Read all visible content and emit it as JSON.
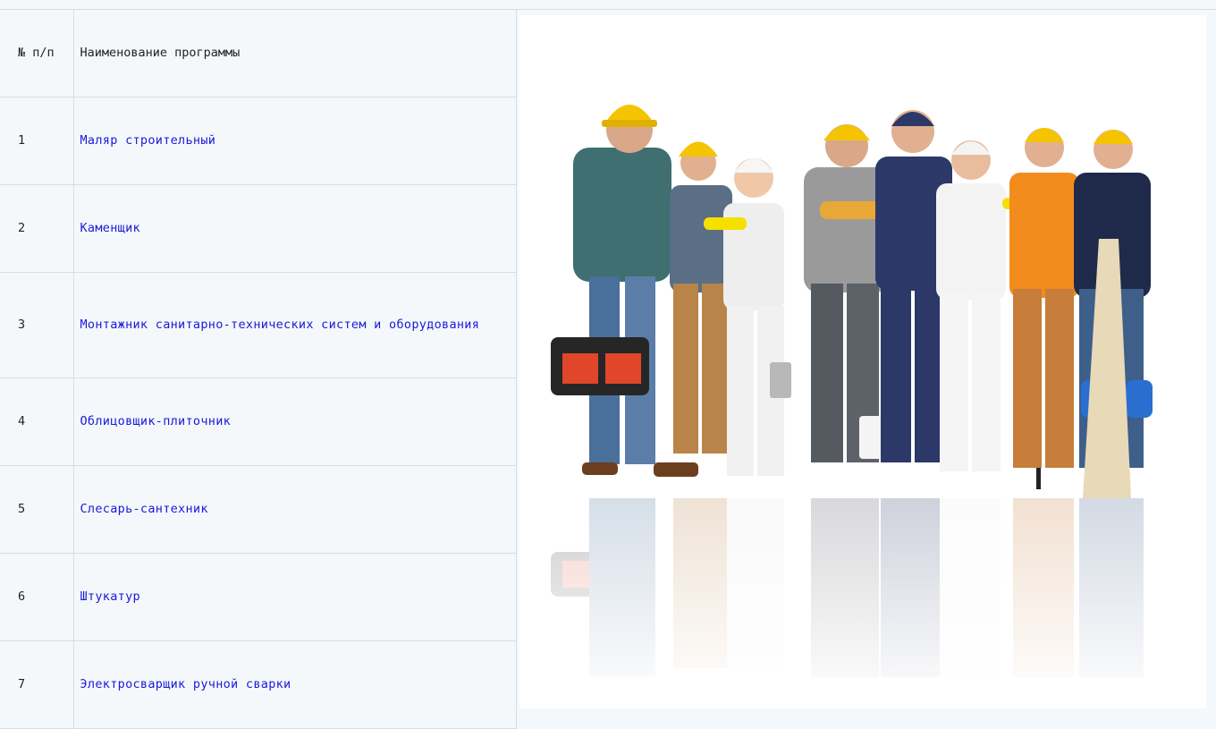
{
  "table": {
    "header": {
      "num": "№ п/п",
      "name": "Наименование программы"
    },
    "rows": [
      {
        "num": "1",
        "name": "Маляр строительный"
      },
      {
        "num": "2",
        "name": "Каменщик"
      },
      {
        "num": "3",
        "name": "Монтажник санитарно-технических систем и оборудования"
      },
      {
        "num": "4",
        "name": "Облицовщик-плиточник"
      },
      {
        "num": "5",
        "name": "Слесарь-сантехник"
      },
      {
        "num": "6",
        "name": "Штукатур"
      },
      {
        "num": "7",
        "name": "Электросварщик ручной сварки"
      }
    ]
  },
  "colors": {
    "link": "#1a1ad8",
    "background": "#f4f8fb",
    "border": "#d9dde0",
    "helmet": "#f5c400"
  },
  "image": {
    "icon": "construction-workers-photo"
  }
}
